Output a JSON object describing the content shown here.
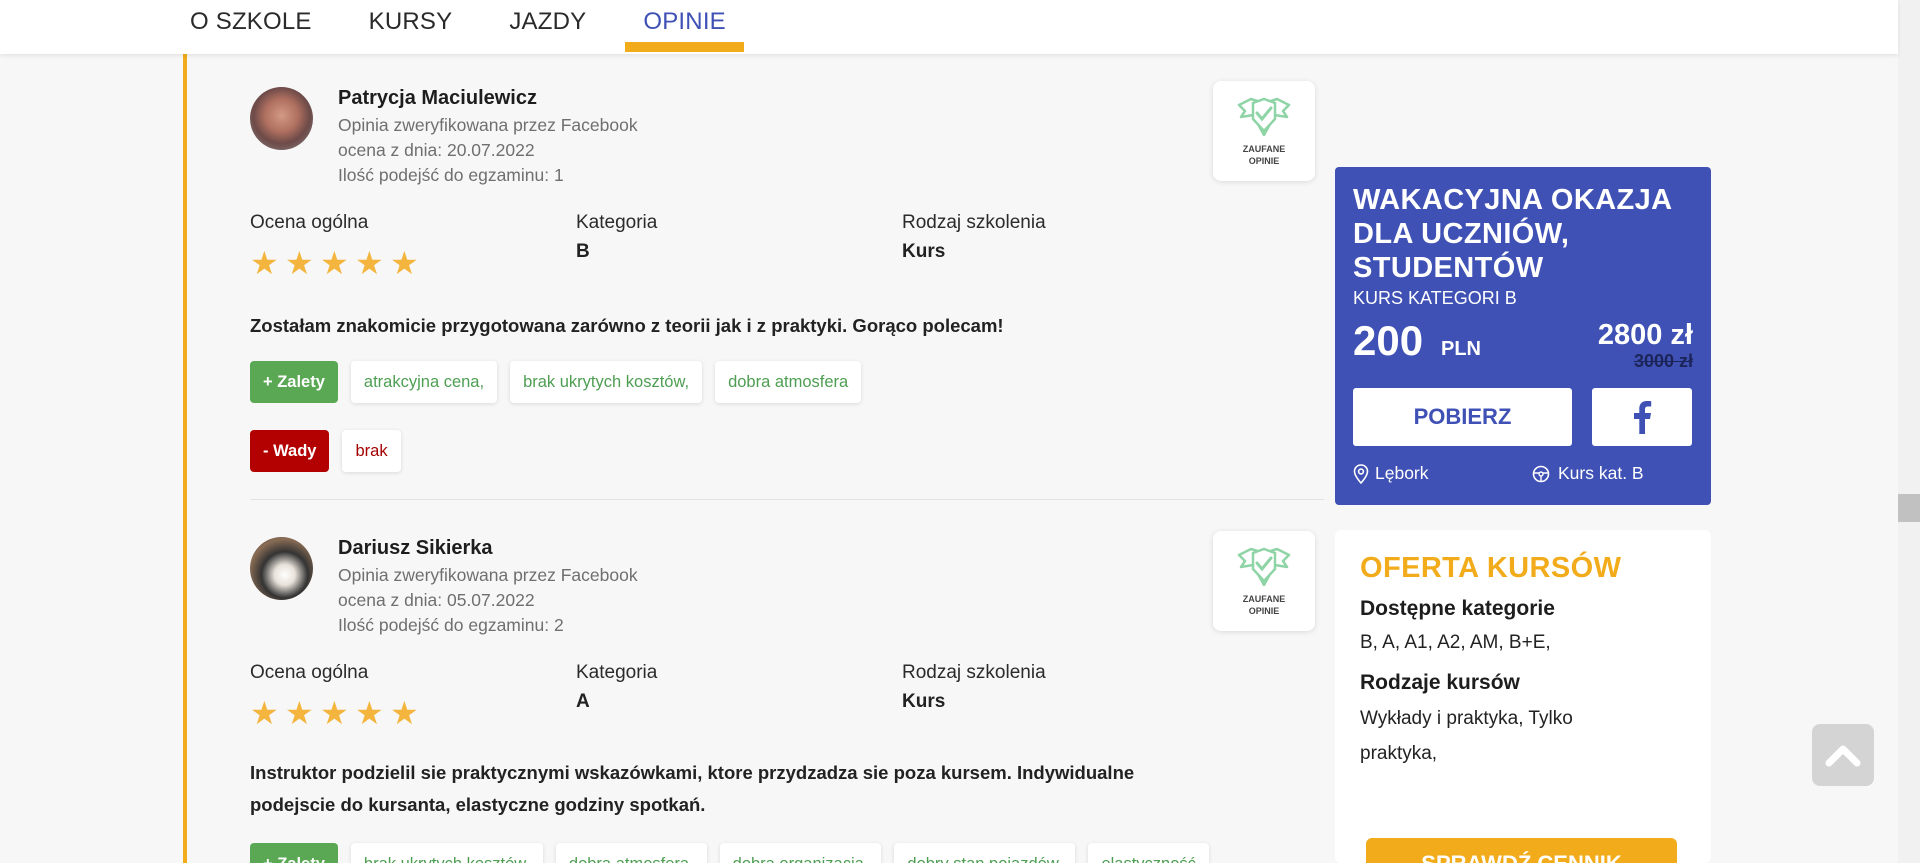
{
  "nav": {
    "items": [
      "O SZKOLE",
      "KURSY",
      "JAZDY",
      "OPINIE"
    ],
    "active": "OPINIE"
  },
  "reviews": [
    {
      "name": "Patrycja Maciulewicz",
      "verified": "Opinia zweryfikowana przez Facebook",
      "date": "ocena z dnia: 20.07.2022",
      "attempts": "Ilość podejść do egzaminu: 1",
      "badge": "ZAUFANE OPINIE",
      "overall_label": "Ocena ogólna",
      "rating": 5,
      "category_label": "Kategoria",
      "category": "B",
      "type_label": "Rodzaj szkolenia",
      "type": "Kurs",
      "text": "Zostałam znakomicie przygotowana zarówno z teorii jak i z praktyki. Gorąco polecam!",
      "pros_label": "+ Zalety",
      "pros": [
        "atrakcyjna cena,",
        "brak ukrytych kosztów,",
        "dobra atmosfera"
      ],
      "cons_label": "- Wady",
      "cons": [
        "brak"
      ]
    },
    {
      "name": "Dariusz Sikierka",
      "verified": "Opinia zweryfikowana przez Facebook",
      "date": "ocena z dnia: 05.07.2022",
      "attempts": "Ilość podejść do egzaminu: 2",
      "badge": "ZAUFANE OPINIE",
      "overall_label": "Ocena ogólna",
      "rating": 5,
      "category_label": "Kategoria",
      "category": "A",
      "type_label": "Rodzaj szkolenia",
      "type": "Kurs",
      "text_line1": "Instruktor podzielil sie praktycznymi wskazówkami, ktore przydzadza sie poza kursem. Indywidualne",
      "text_line2": "podejscie do kursanta, elastyczne godziny spotkań.",
      "pros_label": "+ Zalety",
      "pros": [
        "brak ukrytych kosztów,",
        "dobra atmosfera,",
        "dobra organizacja,",
        "dobry stan pojazdów,",
        "elastyczność"
      ]
    }
  ],
  "promo": {
    "title": "WAKACYJNA OKAZJA DLA UCZNIÓW, STUDENTÓW",
    "subtitle": "KURS KATEGORI B",
    "price": "200",
    "currency": "PLN",
    "new_price": "2800 zł",
    "old_price": "3000 zł",
    "download": "POBIERZ",
    "facebook_icon": "facebook-icon",
    "location": "Lębork",
    "course": "Kurs kat. B"
  },
  "offer": {
    "title": "OFERTA KURSÓW",
    "categories_heading": "Dostępne kategorie",
    "categories": "B, A, A1, A2, AM, B+E,",
    "types_heading": "Rodzaje kursów",
    "types_line1": "Wykłady i praktyka, Tylko",
    "types_line2": "praktyka,",
    "button": "SPRAWDŹ CENNIK"
  },
  "colors": {
    "brand_blue": "#3f51b5",
    "accent_yellow": "#f2ac1b",
    "pro_green": "#5aa754",
    "con_red": "#b30000"
  }
}
